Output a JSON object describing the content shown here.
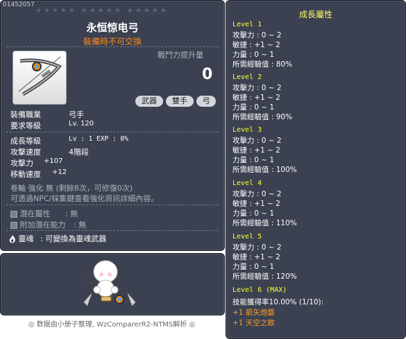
{
  "item": {
    "id": "01452057",
    "stars": "★★★★★ ★★★★★ ★★★★★",
    "name": "永恒惊电弓",
    "trade_note": "裝備時不可交換",
    "power_label": "戰鬥力提升量",
    "power_value": "0",
    "tags": [
      "武器",
      "雙手",
      "弓"
    ],
    "job_label": "裝備職業",
    "job_value": "弓手",
    "req_label": "要求等級",
    "req_value": "Lv. 120",
    "growth_label": "成長等級",
    "growth_value": "Lv : 1   EXP : 0%",
    "speed_label": "攻擊速度",
    "speed_value": "4階段",
    "atk_label": "攻擊力",
    "atk_value": "+107",
    "move_label": "移動速度",
    "move_value": "+12",
    "scroll_line": "卷軸 強化 無 (剩餘8次，可修復0次)",
    "npc_line": "可透過NPC/採集鍵查看強化資訊詳細內容。",
    "potential_label": "潛在屬性",
    "potential_value": ": 無",
    "addpot_label": "附加潛在能力",
    "addpot_value": ": 無",
    "soul_label": "靈魂",
    "soul_value": ": 可變換為靈魂武器"
  },
  "credit": "◎ 数据由小册子整理, WzComparerR2-NTMS解析 ◎",
  "growth": {
    "title": "成長屬性",
    "levels": [
      {
        "label": "Level 1",
        "atk": "攻擊力 : 0 ~ 2",
        "dex": "敏捷 : +1 ~ 2",
        "str": "力量 : 0 ~ 1",
        "exp": "所需經驗值 : 80%"
      },
      {
        "label": "Level 2",
        "atk": "攻擊力 : 0 ~ 2",
        "dex": "敏捷 : +1 ~ 2",
        "str": "力量 : 0 ~ 1",
        "exp": "所需經驗值 : 90%"
      },
      {
        "label": "Level 3",
        "atk": "攻擊力 : 0 ~ 2",
        "dex": "敏捷 : +1 ~ 2",
        "str": "力量 : 0 ~ 1",
        "exp": "所需經驗值 : 100%"
      },
      {
        "label": "Level 4",
        "atk": "攻擊力 : 0 ~ 2",
        "dex": "敏捷 : +1 ~ 2",
        "str": "力量 : 0 ~ 1",
        "exp": "所需經驗值 : 110%"
      },
      {
        "label": "Level 5",
        "atk": "攻擊力 : 0 ~ 2",
        "dex": "敏捷 : +1 ~ 2",
        "str": "力量 : 0 ~ 1",
        "exp": "所需經驗值 : 120%"
      }
    ],
    "final_label": "Level 6 (MAX)",
    "skill_rate": "技能獲得率10.00% (1/10):",
    "skill1": "+1  箭矢炮盤",
    "skill2": "+1  天空之歌"
  }
}
